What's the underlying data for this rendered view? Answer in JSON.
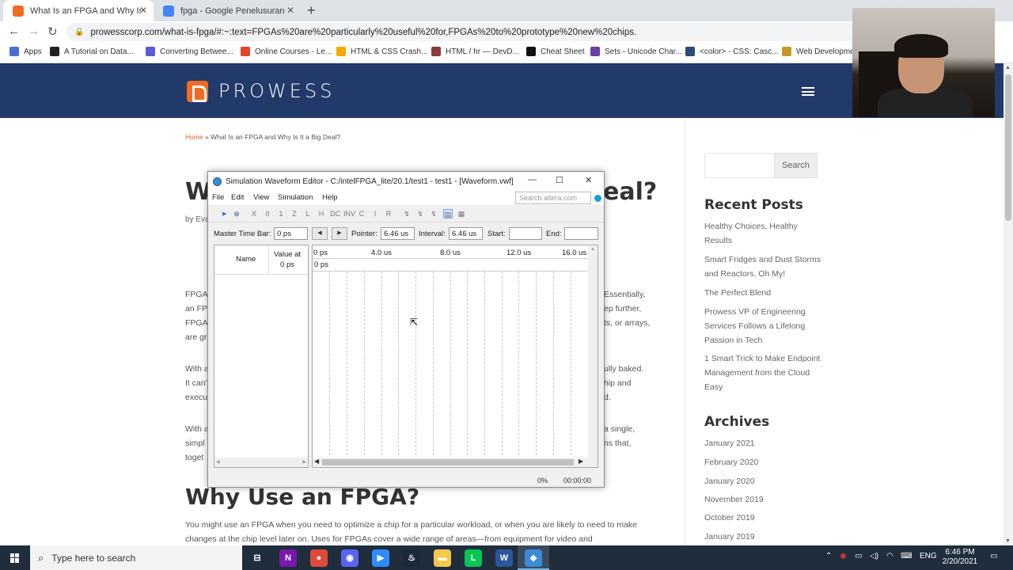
{
  "browser": {
    "tabs": [
      {
        "title": "What Is an FPGA and Why Is It a",
        "favicon_color": "#f26b21",
        "active": true
      },
      {
        "title": "fpga - Google Penelusuran",
        "favicon_color": "#4285f4",
        "active": false
      }
    ],
    "new_tab_glyph": "+",
    "url": "prowesscorp.com/what-is-fpga/#:~:text=FPGAs%20are%20particularly%20useful%20for,FPGAs%20to%20prototype%20new%20chips.",
    "bookmarks": [
      {
        "label": "Apps",
        "icon_color": "#4a6fd4"
      },
      {
        "label": "A Tutorial on Data...",
        "icon_color": "#222222"
      },
      {
        "label": "Converting Betwee...",
        "icon_color": "#5b5bd6"
      },
      {
        "label": "Online Courses - Le...",
        "icon_color": "#e0452c"
      },
      {
        "label": "HTML & CSS Crash...",
        "icon_color": "#f2a900"
      },
      {
        "label": "HTML / hr — DevD...",
        "icon_color": "#8c3b3b"
      },
      {
        "label": "Cheat Sheet",
        "icon_color": "#111111"
      },
      {
        "label": "Sets - Unicode Char...",
        "icon_color": "#6b3fa0"
      },
      {
        "label": "<color> - CSS: Casc...",
        "icon_color": "#2c4a7a"
      },
      {
        "label": "Web Developmer",
        "icon_color": "#c29a2b"
      }
    ]
  },
  "site": {
    "brand": "PROWESS",
    "brand_color": "#f26b21",
    "header_color": "#223a69",
    "breadcrumb": {
      "home": "Home",
      "sep": " » ",
      "current": "What Is an FPGA and Why Is It a Big Deal?"
    },
    "title_start": "Wh",
    "title_end": "eal?",
    "byline": "by Eva",
    "left_fragments": [
      "FPGA",
      "an FP",
      "FPGA",
      "are gr",
      "With a",
      "It can'",
      "execu",
      "With a",
      "simpl",
      "toget"
    ],
    "right_fragments": [
      "Essentially,",
      "ep further,",
      "ts, or arrays,",
      "ully baked.",
      "hip and",
      "d.",
      "a single,",
      "ns that,"
    ],
    "h2": "Why Use an FPGA?",
    "paragraph": "You might use an FPGA when you need to optimize a chip for a particular workload, or when you are likely to need to make changes at the chip level later on. Uses for FPGAs cover a wide range of areas—from equipment for video and"
  },
  "sidebar": {
    "search_button": "Search",
    "recent_heading": "Recent Posts",
    "recent_posts": [
      "Healthy Choices, Healthy Results",
      "Smart Fridges and Dust Storms and Reactors, Oh My!",
      "The Perfect Blend",
      "Prowess VP of Engineering Services Follows a Lifelong Passion in Tech",
      "1 Smart Trick to Make Endpoint Management from the Cloud Easy"
    ],
    "archives_heading": "Archives",
    "archives": [
      "January 2021",
      "February 2020",
      "January 2020",
      "November 2019",
      "October 2019",
      "January 2019"
    ]
  },
  "quartus": {
    "title": "Simulation Waveform Editor - C:/intelFPGA_lite/20.1/test1 - test1 - [Waveform.vwf]",
    "menu": [
      "File",
      "Edit",
      "View",
      "Simulation",
      "Help"
    ],
    "search_placeholder": "Search altera.com",
    "master_time_bar_label": "Master Time Bar:",
    "master_time_bar_value": "0 ps",
    "pointer_label": "Pointer:",
    "pointer_value": "6.46 us",
    "interval_label": "Interval:",
    "interval_value": "6.46 us",
    "start_label": "Start:",
    "start_value": "",
    "end_label": "End:",
    "end_value": "",
    "name_header": "Name",
    "value_header_1": "Value at",
    "value_header_2": "0 ps",
    "time_ticks": [
      "0 ps",
      "4.0 us",
      "8.0 us",
      "12.0 us",
      "16.0 us"
    ],
    "zero_label": "0 ps",
    "status_percent": "0%",
    "status_time": "00:00:00"
  },
  "taskbar": {
    "search_placeholder": "Type here to search",
    "apps": [
      {
        "name": "task-view",
        "color": "#1f2d3d",
        "glyph": "⊟"
      },
      {
        "name": "onenote",
        "color": "#7719aa",
        "glyph": "N"
      },
      {
        "name": "chrome",
        "color": "#dd4b39",
        "glyph": "●"
      },
      {
        "name": "discord",
        "color": "#5865f2",
        "glyph": "◉"
      },
      {
        "name": "zoom",
        "color": "#2d8cff",
        "glyph": "▶"
      },
      {
        "name": "steam",
        "color": "#1b2838",
        "glyph": "♨"
      },
      {
        "name": "file-explorer",
        "color": "#f2c94c",
        "glyph": "▬"
      },
      {
        "name": "line",
        "color": "#06c755",
        "glyph": "L"
      },
      {
        "name": "word",
        "color": "#2b579a",
        "glyph": "W"
      },
      {
        "name": "quartus",
        "color": "#3a8ad6",
        "glyph": "◆"
      }
    ],
    "language": "ENG",
    "time": "6:46 PM",
    "date": "2/20/2021"
  }
}
